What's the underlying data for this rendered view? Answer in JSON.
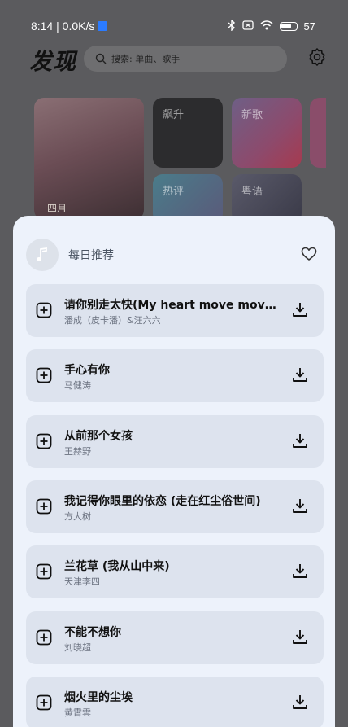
{
  "status_bar": {
    "time_speed": "8:14 | 0.0K/s",
    "battery": "57"
  },
  "header": {
    "title": "发现",
    "search_placeholder": "搜索: 单曲、歌手"
  },
  "cards": {
    "main_month": "四月",
    "tiles": [
      "飙升",
      "新歌",
      "热评",
      "粤语"
    ]
  },
  "sheet": {
    "title": "每日推荐",
    "songs": [
      {
        "title": "请你别走太快(My heart move move...",
        "artist": "潘成（皮卡潘）&汪六六"
      },
      {
        "title": "手心有你",
        "artist": "马健涛"
      },
      {
        "title": "从前那个女孩",
        "artist": "王赫野"
      },
      {
        "title": "我记得你眼里的依恋 (走在红尘俗世间)",
        "artist": "方大树"
      },
      {
        "title": "兰花草 (我从山中来)",
        "artist": "天津李四"
      },
      {
        "title": "不能不想你",
        "artist": "刘晓超"
      },
      {
        "title": "烟火里的尘埃",
        "artist": "黄霄雲"
      }
    ]
  },
  "icons": {
    "search": "search-icon",
    "settings": "gear-icon",
    "favorite": "heart-icon",
    "add": "add-to-playlist-icon",
    "download": "download-icon"
  }
}
